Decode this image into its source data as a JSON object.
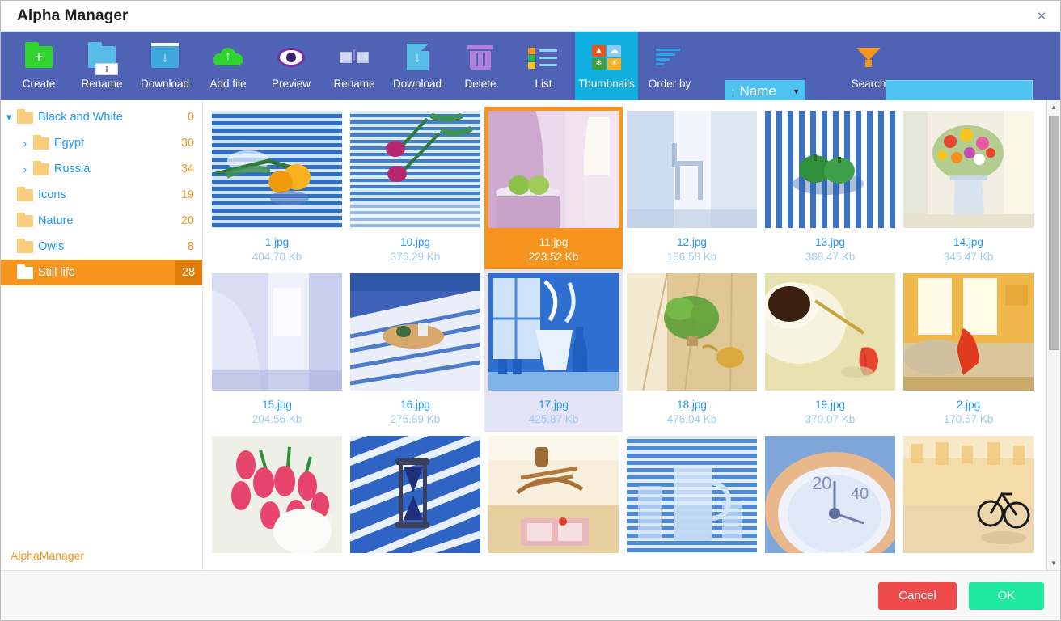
{
  "window": {
    "title": "Alpha Manager",
    "close_icon": "close-icon"
  },
  "toolbar": {
    "items": [
      {
        "label": "Create",
        "icon": "folder-plus-icon",
        "active": false
      },
      {
        "label": "Rename",
        "icon": "folder-rename-icon",
        "active": false
      },
      {
        "label": "Download",
        "icon": "folder-download-icon",
        "active": false
      },
      {
        "label": "Add file",
        "icon": "cloud-upload-icon",
        "active": false
      },
      {
        "label": "Preview",
        "icon": "eye-icon",
        "active": false
      },
      {
        "label": "Rename",
        "icon": "file-rename-icon",
        "active": false
      },
      {
        "label": "Download",
        "icon": "file-download-icon",
        "active": false
      },
      {
        "label": "Delete",
        "icon": "trash-icon",
        "active": false
      },
      {
        "label": "List",
        "icon": "list-view-icon",
        "active": false
      },
      {
        "label": "Thumbnails",
        "icon": "thumbnails-view-icon",
        "active": true
      },
      {
        "label": "Order by",
        "icon": "sort-lines-icon",
        "active": false
      },
      {
        "label": "Search",
        "icon": "funnel-icon",
        "active": false
      }
    ],
    "order_by": {
      "direction_icon": "arrow-up-icon",
      "value": "Name",
      "caret_icon": "chevron-down-icon"
    },
    "search": {
      "value": "",
      "placeholder": ""
    },
    "active_color": "#11aee0",
    "background": "#4f62b4"
  },
  "sidebar": {
    "brand": "AlphaManager",
    "items": [
      {
        "label": "Black and White",
        "count": "0",
        "expanded": true,
        "has_children": true,
        "indent": 0,
        "selected": false
      },
      {
        "label": "Egypt",
        "count": "30",
        "expanded": false,
        "has_children": true,
        "indent": 1,
        "selected": false
      },
      {
        "label": "Russia",
        "count": "34",
        "expanded": false,
        "has_children": true,
        "indent": 1,
        "selected": false
      },
      {
        "label": "Icons",
        "count": "19",
        "expanded": false,
        "has_children": false,
        "indent": 0,
        "selected": false
      },
      {
        "label": "Nature",
        "count": "20",
        "expanded": false,
        "has_children": false,
        "indent": 0,
        "selected": false
      },
      {
        "label": "Owls",
        "count": "8",
        "expanded": false,
        "has_children": false,
        "indent": 0,
        "selected": false
      },
      {
        "label": "Still life",
        "count": "28",
        "expanded": false,
        "has_children": false,
        "indent": 0,
        "selected": true
      }
    ],
    "selected_color": "#f7941e"
  },
  "files": [
    {
      "name": "1.jpg",
      "size": "404.70 Kb",
      "state": "normal",
      "art": "blinds-yellow-tulips"
    },
    {
      "name": "10.jpg",
      "size": "376.29 Kb",
      "state": "normal",
      "art": "blinds-pink-tulips"
    },
    {
      "name": "11.jpg",
      "size": "223.52 Kb",
      "state": "selected",
      "art": "curtain-green-apples"
    },
    {
      "name": "12.jpg",
      "size": "186.58 Kb",
      "state": "normal",
      "art": "window-chair-shadow"
    },
    {
      "name": "13.jpg",
      "size": "388.47 Kb",
      "state": "normal",
      "art": "striped-green-peppers"
    },
    {
      "name": "14.jpg",
      "size": "345.47 Kb",
      "state": "normal",
      "art": "flower-bouquet-vase"
    },
    {
      "name": "15.jpg",
      "size": "204.56 Kb",
      "state": "normal",
      "art": "soft-curtain-light"
    },
    {
      "name": "16.jpg",
      "size": "275.89 Kb",
      "state": "normal",
      "art": "bed-tray-breakfast"
    },
    {
      "name": "17.jpg",
      "size": "425.87 Kb",
      "state": "hover",
      "art": "blue-window-vases"
    },
    {
      "name": "18.jpg",
      "size": "476.04 Kb",
      "state": "normal",
      "art": "plant-watering-can"
    },
    {
      "name": "19.jpg",
      "size": "370.07 Kb",
      "state": "normal",
      "art": "coffee-cup-leaf"
    },
    {
      "name": "2.jpg",
      "size": "170.57 Kb",
      "state": "normal",
      "art": "warm-window-sofa"
    },
    {
      "name": "",
      "size": "",
      "state": "normal",
      "art": "pink-tulips-jug"
    },
    {
      "name": "",
      "size": "",
      "state": "normal",
      "art": "hourglass-blinds"
    },
    {
      "name": "",
      "size": "",
      "state": "normal",
      "art": "wooden-horse-rug"
    },
    {
      "name": "",
      "size": "",
      "state": "normal",
      "art": "glass-pitcher-blinds"
    },
    {
      "name": "",
      "size": "",
      "state": "normal",
      "art": "clock-closeup"
    },
    {
      "name": "",
      "size": "",
      "state": "normal",
      "art": "mini-bicycle-warm"
    }
  ],
  "scrollbar": {
    "up_icon": "chevron-up-icon",
    "down_icon": "chevron-down-icon"
  },
  "footer": {
    "cancel_label": "Cancel",
    "ok_label": "OK",
    "cancel_color": "#ef4b4b",
    "ok_color": "#1fe8a0"
  }
}
